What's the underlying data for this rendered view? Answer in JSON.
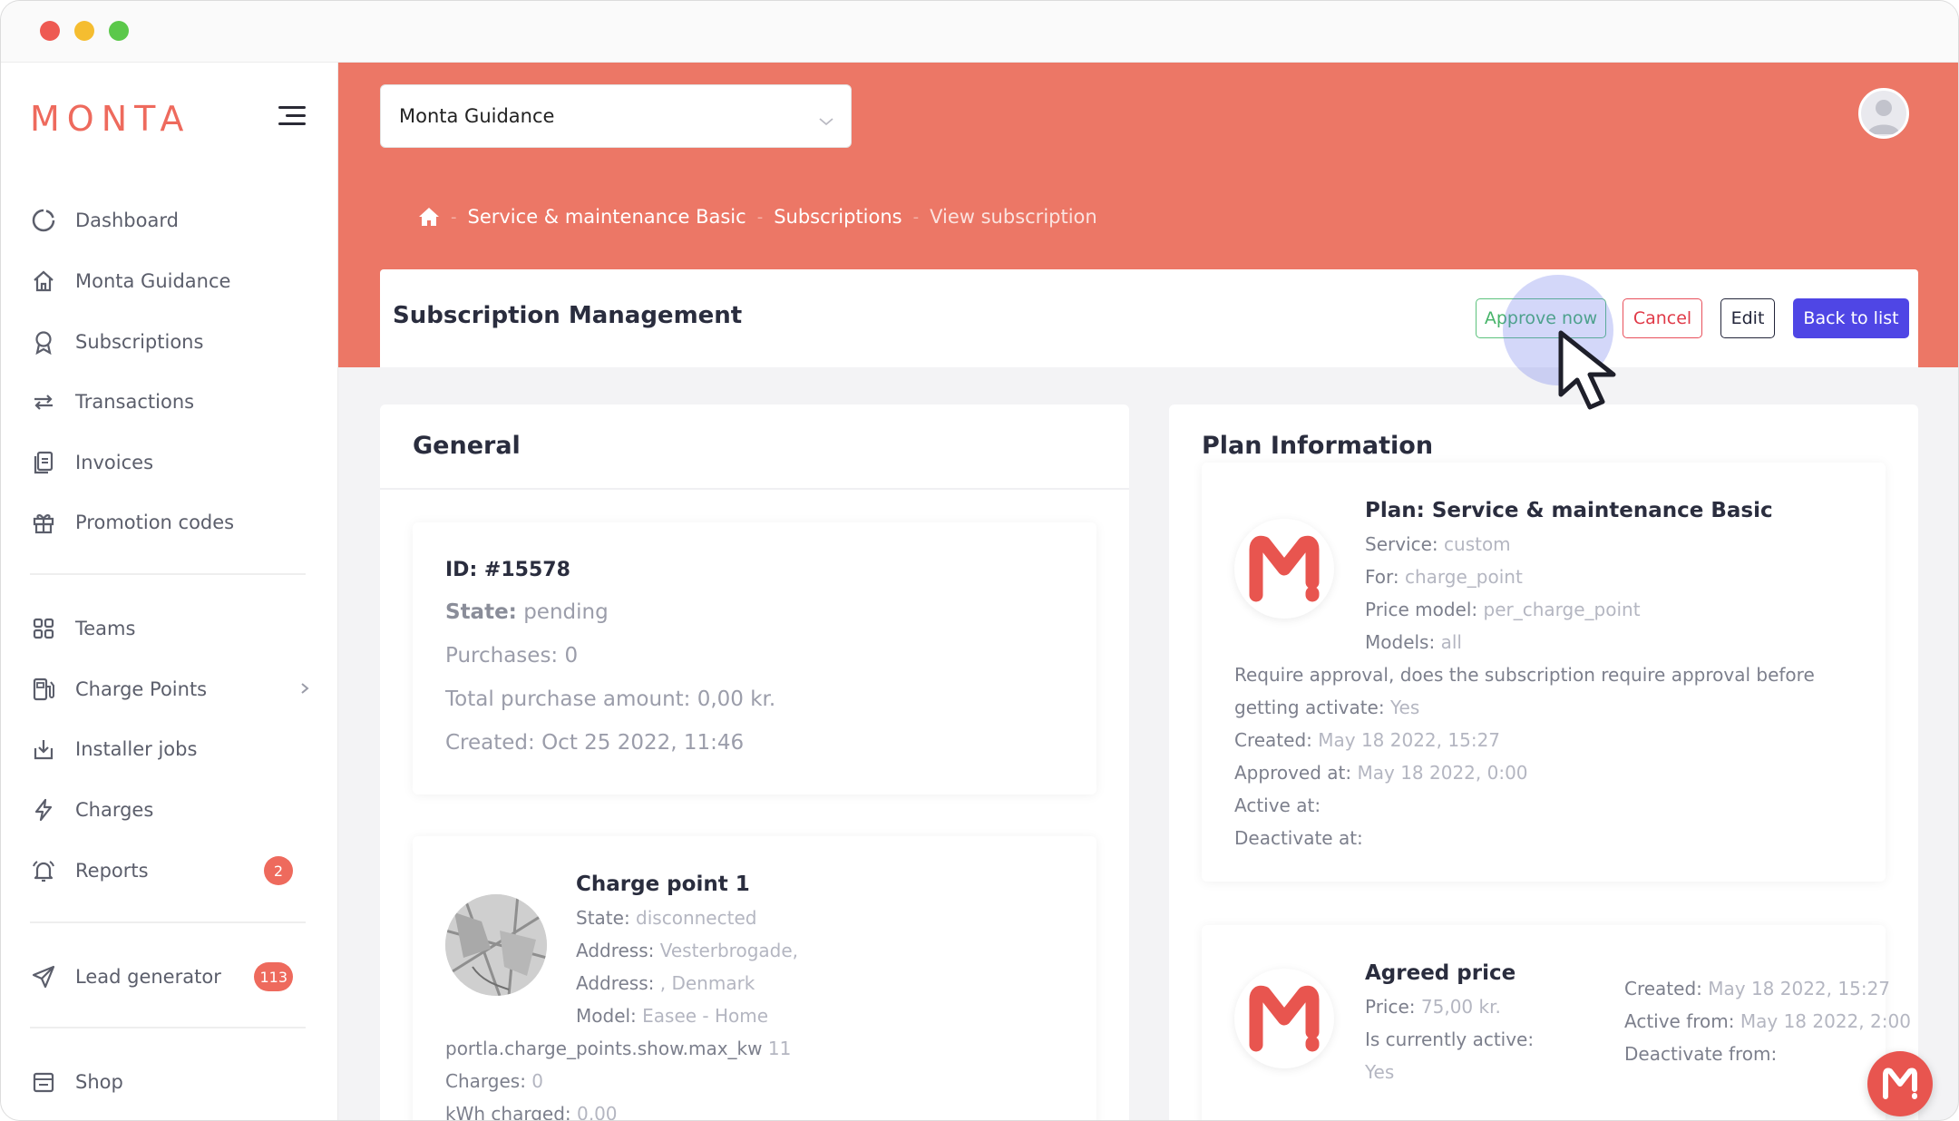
{
  "window": {
    "controls": [
      "close",
      "minimize",
      "maximize"
    ]
  },
  "brand": {
    "logo_text": "MONTA",
    "accent": "#ec7766",
    "primary_button": "#4f46e5"
  },
  "sidebar": {
    "items": [
      {
        "label": "Dashboard",
        "icon": "dashboard-icon"
      },
      {
        "label": "Monta Guidance",
        "icon": "home-icon"
      },
      {
        "label": "Subscriptions",
        "icon": "award-icon"
      },
      {
        "label": "Transactions",
        "icon": "transfer-arrows-icon"
      },
      {
        "label": "Invoices",
        "icon": "invoice-icon"
      },
      {
        "label": "Promotion codes",
        "icon": "gift-icon"
      },
      {
        "label": "Teams",
        "icon": "grid-icon"
      },
      {
        "label": "Charge Points",
        "icon": "fuel-pump-icon"
      },
      {
        "label": "Installer jobs",
        "icon": "download-tray-icon"
      },
      {
        "label": "Charges",
        "icon": "lightning-icon"
      },
      {
        "label": "Reports",
        "icon": "bell-icon",
        "badge": "2"
      },
      {
        "label": "Lead generator",
        "icon": "paper-plane-icon",
        "badge": "113"
      },
      {
        "label": "Shop",
        "icon": "shop-icon"
      }
    ]
  },
  "header": {
    "org_select": "Monta Guidance",
    "breadcrumb": [
      "Service & maintenance Basic",
      "Subscriptions",
      "View subscription"
    ]
  },
  "toolbar": {
    "title": "Subscription Management",
    "approve": "Approve now",
    "cancel": "Cancel",
    "edit": "Edit",
    "back": "Back to list"
  },
  "general": {
    "title": "General",
    "id_label": "ID: #15578",
    "state_key": "State:",
    "state_value": "pending",
    "purchases": "Purchases: 0",
    "total_purchase": "Total purchase amount: 0,00 kr.",
    "created": "Created: Oct 25 2022, 11:46"
  },
  "charge_point": {
    "title": "Charge point 1",
    "state_key": "State:",
    "state_value": "disconnected",
    "address1_key": "Address:",
    "address1_value": "Vesterbrogade,",
    "address2_key": "Address:",
    "address2_value": ", Denmark",
    "model_key": "Model:",
    "model_value": "Easee - Home",
    "max_kw_key": "portla.charge_points.show.max_kw",
    "max_kw_value": "11",
    "charges_key": "Charges:",
    "charges_value": "0",
    "kwh_key": "kWh charged:",
    "kwh_value": "0,00"
  },
  "plan": {
    "section_title": "Plan Information",
    "title": "Plan: Service & maintenance Basic",
    "service_key": "Service:",
    "service_value": "custom",
    "for_key": "For:",
    "for_value": "charge_point",
    "price_model_key": "Price model:",
    "price_model_value": "per_charge_point",
    "models_key": "Models:",
    "models_value": "all",
    "require_line1": "Require approval, does the subscription require approval before",
    "require_line2_key": "getting activate:",
    "require_value": "Yes",
    "created_key": "Created:",
    "created_value": "May 18 2022, 15:27",
    "approved_key": "Approved at:",
    "approved_value": "May 18 2022, 0:00",
    "active_key": "Active at:",
    "deactivate_key": "Deactivate at:"
  },
  "agreed": {
    "title": "Agreed price",
    "price_key": "Price:",
    "price_value": "75,00 kr.",
    "active_key": "Is currently active:",
    "active_value": "Yes",
    "created_key": "Created:",
    "created_value": "May 18 2022, 15:27",
    "active_from_key": "Active from:",
    "active_from_value": "May 18 2022, 2:00",
    "deactivate_from_key": "Deactivate from:"
  }
}
